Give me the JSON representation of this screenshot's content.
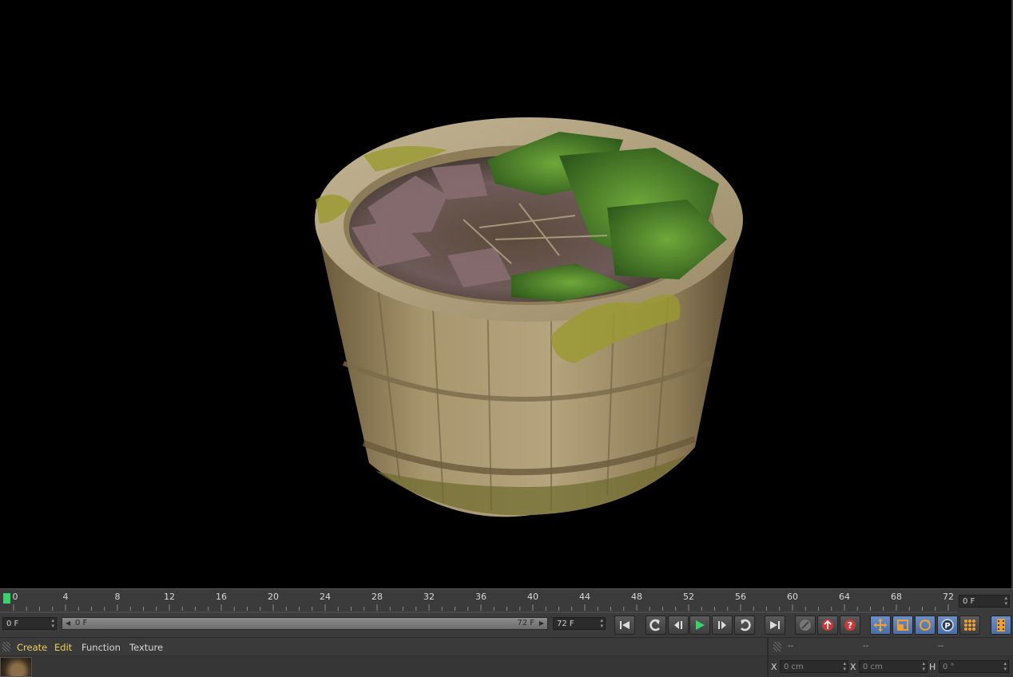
{
  "timeline": {
    "ticks": [
      "0",
      "4",
      "8",
      "12",
      "16",
      "20",
      "24",
      "28",
      "32",
      "36",
      "40",
      "44",
      "48",
      "52",
      "56",
      "60",
      "64",
      "68",
      "72"
    ],
    "end_frame_field": "0 F"
  },
  "transport": {
    "current_frame": "0 F",
    "range_start": "0 F",
    "range_end": "72 F",
    "max_frame": "72 F"
  },
  "material_menu": {
    "create": "Create",
    "edit": "Edit",
    "function": "Function",
    "texture": "Texture"
  },
  "coordinates": {
    "header": [
      "--",
      "--",
      "--"
    ],
    "x_label": "X",
    "x_value": "0 cm",
    "x2_label": "X",
    "x2_value": "0 cm",
    "h_label": "H",
    "h_value": "0 °"
  },
  "colors": {
    "accent_green": "#39d36c",
    "highlight_yellow": "#f0d060",
    "active_blue": "#5a7fbc",
    "record_red": "#c83a3a"
  },
  "icons": [
    "first-frame-icon",
    "prev-key-icon",
    "prev-frame-icon",
    "play-icon",
    "next-frame-icon",
    "next-key-icon",
    "last-frame-icon",
    "keyframe-disabled-icon",
    "record-icon",
    "autokey-icon",
    "move-key-icon",
    "scale-key-icon",
    "rotate-key-icon",
    "param-key-icon",
    "point-level-icon",
    "film-icon"
  ]
}
